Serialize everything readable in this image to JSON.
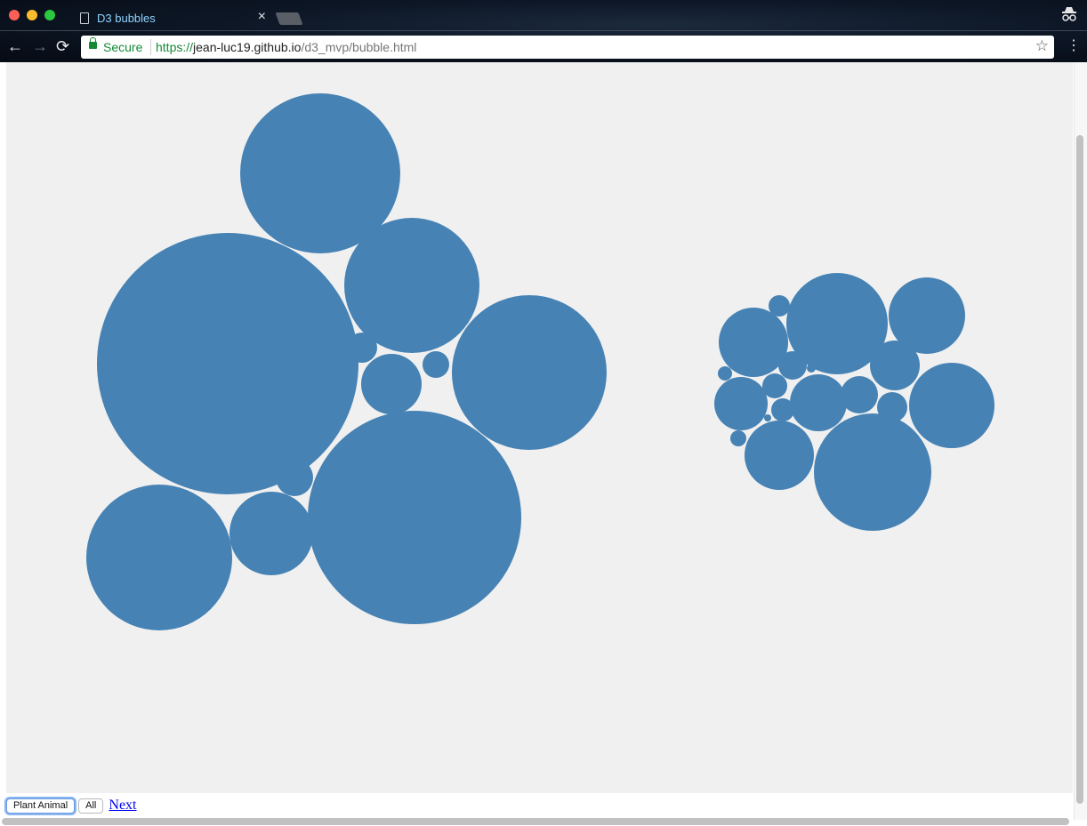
{
  "browser": {
    "tab_title": "D3 bubbles",
    "tab_close": "×",
    "security_label": "Secure",
    "url_scheme": "https://",
    "url_host": "jean-luc19.github.io",
    "url_path": "/d3_mvp/bubble.html",
    "back_icon": "←",
    "forward_icon": "→",
    "reload_icon": "⟳",
    "star_icon": "☆",
    "menu_icon": "⋮",
    "incognito_icon": "👓"
  },
  "controls": {
    "plant_animal_label": "Plant Animal",
    "all_label": "All",
    "next_label": "Next"
  },
  "chart_data": {
    "type": "bubble",
    "title": "",
    "fill_color": "#4682b4",
    "background_color": "#f0f0f0",
    "groups": [
      {
        "name": "left-cluster",
        "relative_radii": [
          147,
          120,
          90,
          87,
          82,
          76,
          47,
          34,
          21,
          17,
          15
        ]
      },
      {
        "name": "right-cluster",
        "relative_radii": [
          66,
          57,
          48,
          43,
          39,
          39,
          32,
          30,
          28,
          21,
          17,
          16,
          14,
          13,
          12,
          9,
          8,
          5,
          4
        ]
      }
    ]
  }
}
